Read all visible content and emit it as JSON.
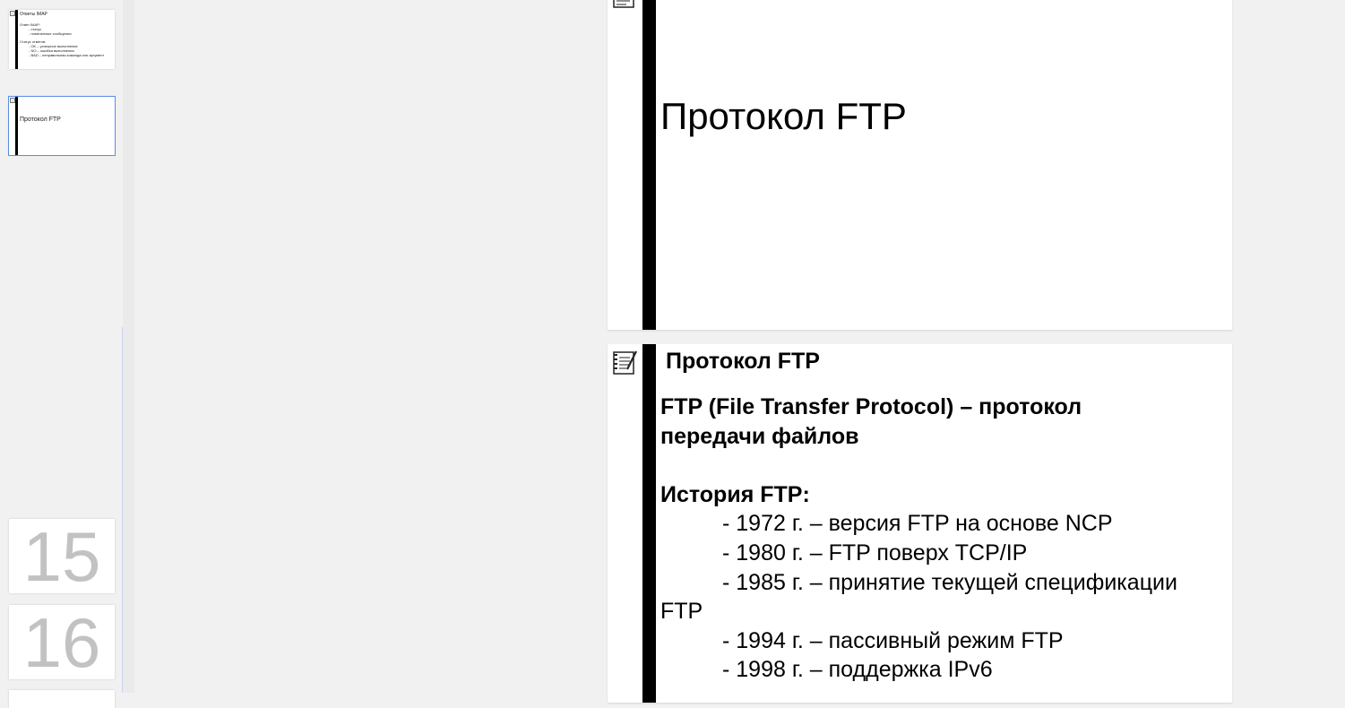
{
  "thumbnails": {
    "imap_slide": {
      "title": "Ответы IMAP",
      "line1": "Ответ IMAP:",
      "line2": "- статус",
      "line3": "- помеченные сообщения",
      "line4": "Статус ответов:",
      "line5": "- OK – успешное выполнение",
      "line6": "- NO – ошибка выполнения",
      "line7": "- BAD – неправильная команда или аргумент"
    },
    "ftp_title_slide": {
      "title": "Протокол FTP"
    },
    "slide_15": {
      "number": "15"
    },
    "slide_16": {
      "number": "16"
    }
  },
  "slides": {
    "title_slide": {
      "title": "Протокол FTP"
    },
    "content_slide": {
      "heading": "Протокол FTP",
      "definition_line1": "FTP (File Transfer Protocol) – протокол",
      "definition_line2": "передачи файлов",
      "history_heading": "История FTP:",
      "history": [
        "- 1972 г. – версия FTP на основе NCP",
        "- 1980 г. – FTP поверх TCP/IP",
        "- 1985 г. – принятие текущей спецификации",
        "FTP",
        "- 1994 г. – пассивный режим FTP",
        "- 1998 г. – поддержка IPv6"
      ]
    }
  },
  "colors": {
    "selection": "#5b8de6",
    "panel": "#f1f1f1",
    "accent_bar": "#000000"
  },
  "icons": {
    "notes": "notes-icon"
  }
}
